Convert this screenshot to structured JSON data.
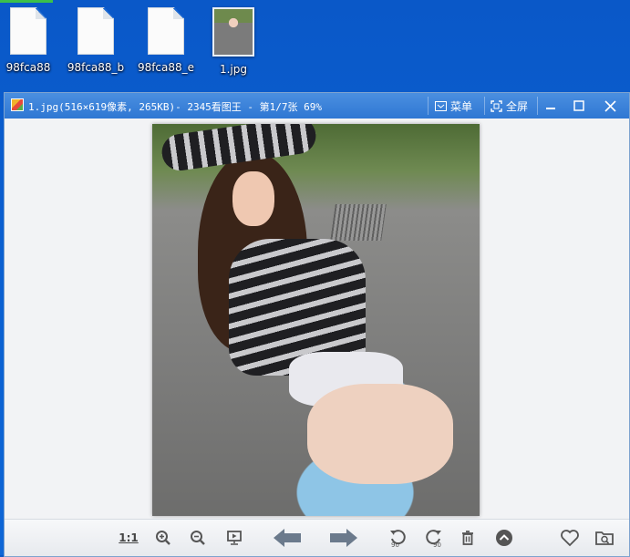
{
  "desktop": {
    "icons": [
      {
        "label": "98fca88",
        "kind": "file"
      },
      {
        "label": "98fca88_b",
        "kind": "file"
      },
      {
        "label": "98fca88_e",
        "kind": "file"
      },
      {
        "label": "1.jpg",
        "kind": "image"
      }
    ]
  },
  "viewer": {
    "title": "1.jpg(516×619像素, 265KB)- 2345看图王 - 第1/7张 69%",
    "menu_label": "菜单",
    "fullscreen_label": "全屏",
    "bottom": {
      "actual_size_label": "1:1",
      "rotate_left_label": "90",
      "rotate_right_label": "90"
    }
  },
  "icons": {
    "menu": "menu-icon",
    "fullscreen": "fullscreen-icon",
    "minimize": "minimize-icon",
    "maximize": "maximize-icon",
    "close": "close-icon"
  },
  "colors": {
    "desktop_bg": "#0b5fd0",
    "titlebar": "#3a80d9",
    "nav_arrow": "#6b7a8c"
  }
}
